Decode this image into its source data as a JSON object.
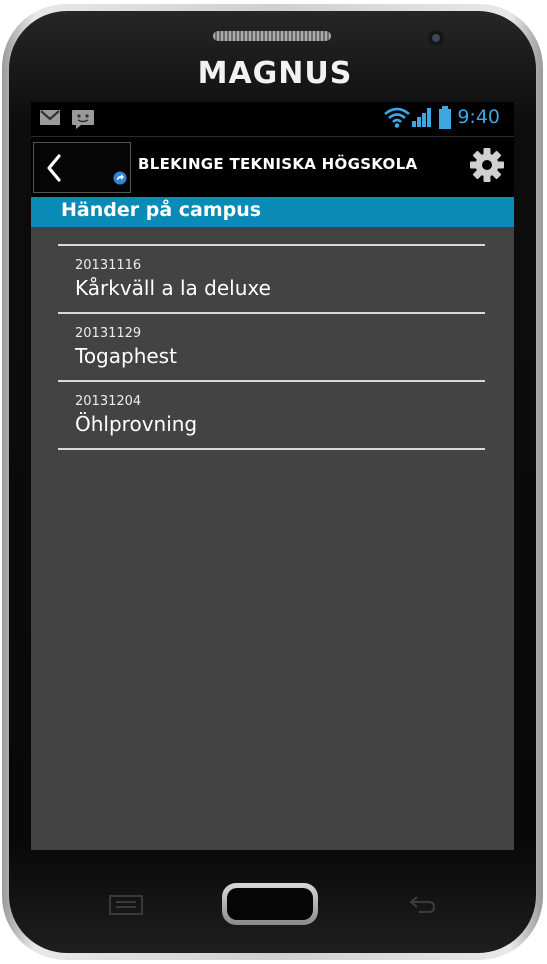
{
  "device": {
    "brand": "MAGNUS"
  },
  "statusbar": {
    "time": "9:40",
    "icons": [
      "gmail-icon",
      "messaging-icon",
      "wifi-icon",
      "signal-icon",
      "battery-icon"
    ]
  },
  "actionbar": {
    "back_icon": "chevron-left-icon",
    "title": "BLEKINGE TEKNISKA HÖGSKOLA",
    "settings_icon": "gear-icon"
  },
  "section": {
    "title": "Händer på campus"
  },
  "events": [
    {
      "date": "20131116",
      "title": "Kårkväll a la deluxe"
    },
    {
      "date": "20131129",
      "title": "Togaphest"
    },
    {
      "date": "20131204",
      "title": "Öhlprovning"
    }
  ],
  "colors": {
    "accent_blue": "#0a8ab6",
    "status_blue": "#3ea6e0",
    "screen_bg": "#434343",
    "bar_bg": "#000000"
  }
}
